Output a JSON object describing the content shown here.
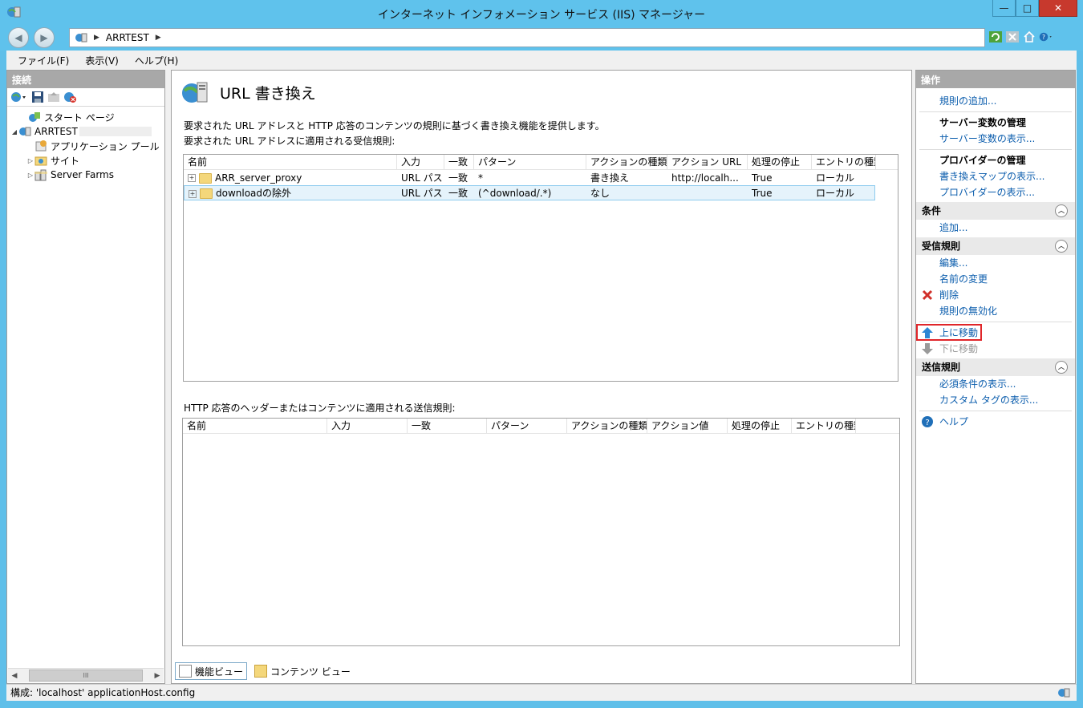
{
  "window": {
    "title": "インターネット インフォメーション サービス (IIS) マネージャー",
    "min": "—",
    "max": "□",
    "close": "✕"
  },
  "address": {
    "crumb": "ARRTEST"
  },
  "menu": [
    "ファイル(F)",
    "表示(V)",
    "ヘルプ(H)"
  ],
  "connections": {
    "header": "接続",
    "tree": [
      {
        "label": "スタート ページ",
        "exp": "",
        "indent": 16
      },
      {
        "label": "ARRTEST",
        "exp": "◢",
        "indent": 4
      },
      {
        "label": "アプリケーション プール",
        "exp": "",
        "indent": 34
      },
      {
        "label": "サイト",
        "exp": "▷",
        "indent": 24
      },
      {
        "label": "Server Farms",
        "exp": "▷",
        "indent": 24
      }
    ],
    "scroll_thumb": "III"
  },
  "main": {
    "title": "URL 書き換え",
    "desc": "要求された URL アドレスと HTTP 応答のコンテンツの規則に基づく書き換え機能を提供します。",
    "inbound_label": "要求された URL アドレスに適用される受信規則:",
    "inbound_columns": [
      "名前",
      "入力",
      "一致",
      "パターン",
      "アクションの種類",
      "アクション URL",
      "処理の停止",
      "エントリの種類"
    ],
    "inbound_rows": [
      [
        "ARR_server_proxy",
        "URL パス",
        "一致",
        "*",
        "書き換え",
        "http://localh...",
        "True",
        "ローカル"
      ],
      [
        "downloadの除外",
        "URL パス",
        "一致",
        "(^download/.*)",
        "なし",
        "",
        "True",
        "ローカル"
      ]
    ],
    "outbound_label": "HTTP 応答のヘッダーまたはコンテンツに適用される送信規則:",
    "outbound_columns": [
      "名前",
      "入力",
      "一致",
      "パターン",
      "アクションの種類",
      "アクション値",
      "処理の停止",
      "エントリの種類"
    ]
  },
  "tabs": {
    "feature": "機能ビュー",
    "content": "コンテンツ ビュー"
  },
  "actions": {
    "header": "操作",
    "add_rule": "規則の追加...",
    "server_vars_title": "サーバー変数の管理",
    "server_vars_show": "サーバー変数の表示...",
    "providers_title": "プロバイダーの管理",
    "rewrite_maps": "書き換えマップの表示...",
    "providers_show": "プロバイダーの表示...",
    "conditions": "条件",
    "cond_add": "追加...",
    "inbound": "受信規則",
    "edit": "編集...",
    "rename": "名前の変更",
    "delete": "削除",
    "disable": "規則の無効化",
    "move_up": "上に移動",
    "move_down": "下に移動",
    "outbound": "送信規則",
    "preconditions": "必須条件の表示...",
    "custom_tags": "カスタム タグの表示...",
    "help": "ヘルプ"
  },
  "status": {
    "text": "構成: 'localhost' applicationHost.config"
  },
  "colors": {
    "titlebar": "#5fc2ec",
    "close": "#c7392d",
    "link": "#0b5dad",
    "highlight": "#e0262a"
  }
}
